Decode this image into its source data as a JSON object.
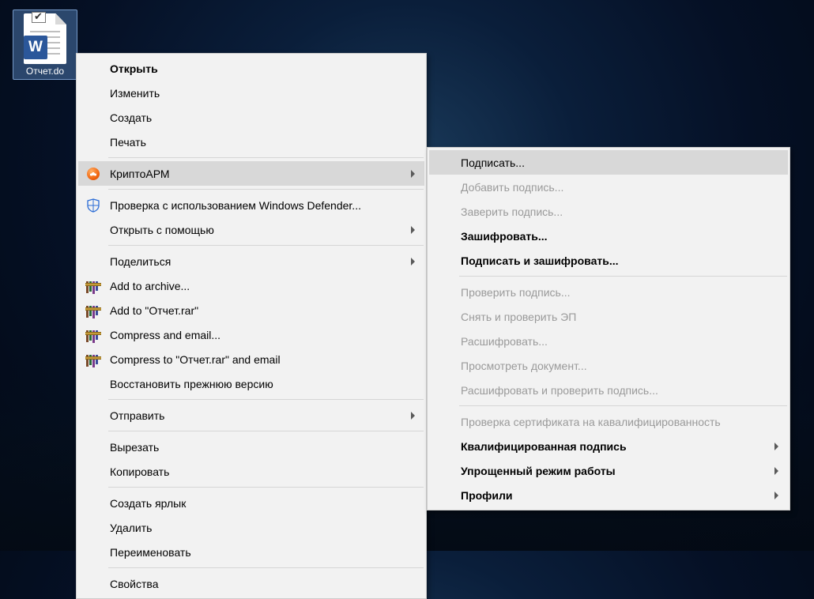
{
  "desktop": {
    "file_label": "Отчет.do",
    "word_badge": "W"
  },
  "main_menu": {
    "open": "Открыть",
    "edit": "Изменить",
    "create": "Создать",
    "print": "Печать",
    "cryptoarm": "КриптоАРМ",
    "defender": "Проверка с использованием Windows Defender...",
    "open_with": "Открыть с помощью",
    "share": "Поделиться",
    "rar_add": "Add to archive...",
    "rar_add_named": "Add to \"Отчет.rar\"",
    "rar_email": "Compress and email...",
    "rar_email_named": "Compress to \"Отчет.rar\" and email",
    "restore": "Восстановить прежнюю версию",
    "send": "Отправить",
    "cut": "Вырезать",
    "copy": "Копировать",
    "shortcut": "Создать ярлык",
    "delete": "Удалить",
    "rename": "Переименовать",
    "properties": "Свойства"
  },
  "sub_menu": {
    "sign": "Подписать...",
    "add_sign": "Добавить подпись...",
    "certify_sign": "Заверить подпись...",
    "encrypt": "Зашифровать...",
    "sign_encrypt": "Подписать и зашифровать...",
    "verify_sign": "Проверить подпись...",
    "remove_verify": "Снять и проверить ЭП",
    "decrypt": "Расшифровать...",
    "view_doc": "Просмотреть документ...",
    "decrypt_verify": "Расшифровать и проверить подпись...",
    "cert_check": "Проверка сертификата на кавалифицированность",
    "qualified_sign": "Квалифицированная подпись",
    "simple_mode": "Упрощенный режим работы",
    "profiles": "Профили"
  }
}
